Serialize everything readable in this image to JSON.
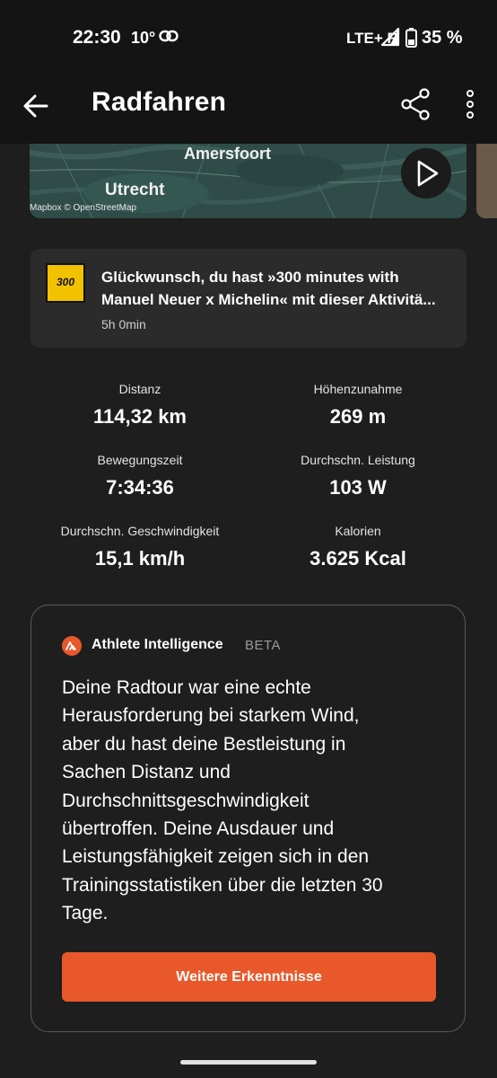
{
  "status": {
    "time": "22:30",
    "temp": "10°",
    "network": "LTE+ R",
    "battery": "35 %"
  },
  "appbar": {
    "title": "Radfahren",
    "back_icon": "arrow-left-icon",
    "share_icon": "share-icon",
    "more_icon": "more-vertical-icon"
  },
  "map": {
    "city_1": "Amersfoort",
    "city_2": "Utrecht",
    "attribution": "Mapbox © OpenStreetMap",
    "play_icon": "play-icon"
  },
  "achievement": {
    "badge_text": "300",
    "line_1": "Glückwunsch, du hast »300 minutes with",
    "line_2": "Manuel Neuer x Michelin« mit dieser Aktivitä...",
    "time": "5h 0min"
  },
  "stats": [
    {
      "label": "Distanz",
      "value": "114,32 km"
    },
    {
      "label": "Höhenzunahme",
      "value": "269 m"
    },
    {
      "label": "Bewegungszeit",
      "value": "7:34:36"
    },
    {
      "label": "Durchschn. Leistung",
      "value": "103 W"
    },
    {
      "label": "Durchschn. Geschwindigkeit",
      "value": "15,1 km/h"
    },
    {
      "label": "Kalorien",
      "value": "3.625 Kcal"
    }
  ],
  "athlete_intelligence": {
    "title": "Athlete Intelligence",
    "badge": "BETA",
    "body_lines": [
      "Deine Radtour war eine echte",
      "Herausforderung bei starkem Wind,",
      "aber du hast deine Bestleistung in",
      "Sachen Distanz und",
      "Durchschnittsgeschwindigkeit",
      "übertroffen. Deine Ausdauer und",
      "Leistungsfähigkeit zeigen sich in den",
      "Trainingsstatistiken über die letzten 30",
      "Tage."
    ],
    "button_label": "Weitere Erkenntnisse"
  },
  "colors": {
    "accent": "#e8582a",
    "background": "#1e1e1e",
    "card": "#2b2b2b",
    "badge": "#f2c200"
  }
}
